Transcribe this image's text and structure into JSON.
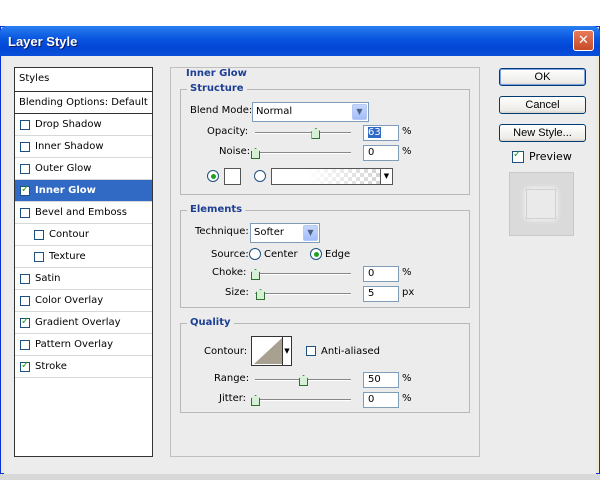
{
  "window": {
    "title": "Layer Style",
    "close_glyph": "✕"
  },
  "styles_panel": {
    "header": "Styles",
    "blending_options": "Blending Options: Default",
    "items": [
      {
        "label": "Drop Shadow",
        "checked": false,
        "selected": false,
        "sub": false
      },
      {
        "label": "Inner Shadow",
        "checked": false,
        "selected": false,
        "sub": false
      },
      {
        "label": "Outer Glow",
        "checked": false,
        "selected": false,
        "sub": false
      },
      {
        "label": "Inner Glow",
        "checked": true,
        "selected": true,
        "sub": false
      },
      {
        "label": "Bevel and Emboss",
        "checked": false,
        "selected": false,
        "sub": false
      },
      {
        "label": "Contour",
        "checked": false,
        "selected": false,
        "sub": true
      },
      {
        "label": "Texture",
        "checked": false,
        "selected": false,
        "sub": true
      },
      {
        "label": "Satin",
        "checked": false,
        "selected": false,
        "sub": false
      },
      {
        "label": "Color Overlay",
        "checked": false,
        "selected": false,
        "sub": false
      },
      {
        "label": "Gradient Overlay",
        "checked": true,
        "selected": false,
        "sub": false
      },
      {
        "label": "Pattern Overlay",
        "checked": false,
        "selected": false,
        "sub": false
      },
      {
        "label": "Stroke",
        "checked": true,
        "selected": false,
        "sub": false
      }
    ]
  },
  "inner_glow": {
    "title": "Inner Glow",
    "structure": {
      "title": "Structure",
      "blend_mode_label": "Blend Mode:",
      "blend_mode_value": "Normal",
      "opacity_label": "Opacity:",
      "opacity_value": "63",
      "opacity_level": 0.63,
      "noise_label": "Noise:",
      "noise_value": "0",
      "noise_level": 0,
      "unit": "%"
    },
    "elements": {
      "title": "Elements",
      "technique_label": "Technique:",
      "technique_value": "Softer",
      "source_label": "Source:",
      "source_center": "Center",
      "source_edge": "Edge",
      "source_selected": "Edge",
      "choke_label": "Choke:",
      "choke_value": "0",
      "choke_unit": "%",
      "size_label": "Size:",
      "size_value": "5",
      "size_unit": "px"
    },
    "quality": {
      "title": "Quality",
      "contour_label": "Contour:",
      "anti_aliased_label": "Anti-aliased",
      "anti_aliased": false,
      "range_label": "Range:",
      "range_value": "50",
      "range_unit": "%",
      "jitter_label": "Jitter:",
      "jitter_value": "0",
      "jitter_unit": "%"
    }
  },
  "buttons": {
    "ok": "OK",
    "cancel": "Cancel",
    "new_style": "New Style...",
    "preview_label": "Preview",
    "preview_checked": true
  },
  "colors": {
    "accent": "#316ac5",
    "title_bar": "#0a58e0",
    "label_blue": "#1c3f94"
  }
}
